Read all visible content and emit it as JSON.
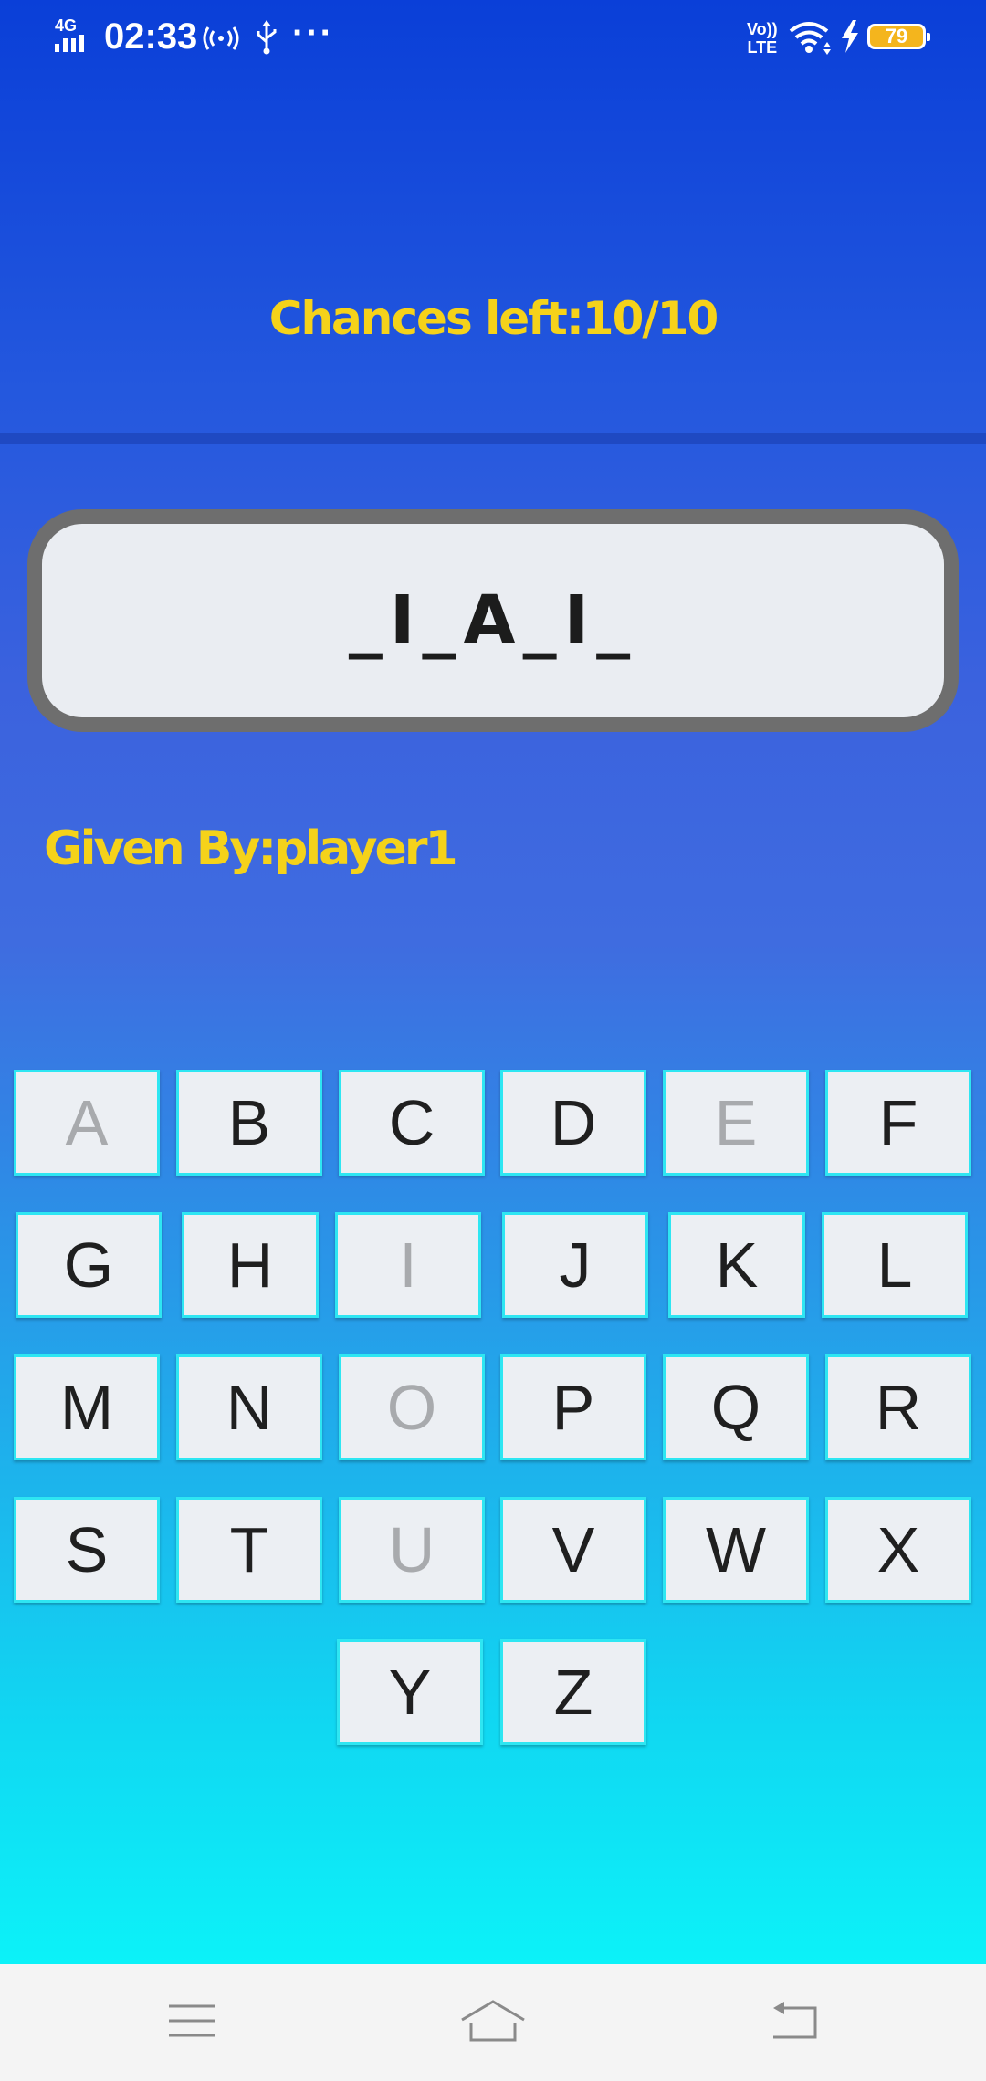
{
  "status_bar": {
    "network": "4G",
    "time": "02:33",
    "volte_top": "Vo))",
    "volte_bottom": "LTE",
    "more": "···",
    "battery": "79",
    "icons": [
      "signal-icon",
      "hotspot-icon",
      "usb-icon",
      "more-icon",
      "volte-icon",
      "wifi-icon",
      "charging-icon",
      "battery-icon"
    ]
  },
  "game": {
    "chances_text": "Chances left:10/10",
    "word_display": "_I_A_I_",
    "given_by_text": "Given By:player1"
  },
  "keyboard": {
    "keys": [
      {
        "letter": "A",
        "used": true
      },
      {
        "letter": "B",
        "used": false
      },
      {
        "letter": "C",
        "used": false
      },
      {
        "letter": "D",
        "used": false
      },
      {
        "letter": "E",
        "used": true
      },
      {
        "letter": "F",
        "used": false
      },
      {
        "letter": "G",
        "used": false
      },
      {
        "letter": "H",
        "used": false
      },
      {
        "letter": "I",
        "used": true
      },
      {
        "letter": "J",
        "used": false
      },
      {
        "letter": "K",
        "used": false
      },
      {
        "letter": "L",
        "used": false
      },
      {
        "letter": "M",
        "used": false
      },
      {
        "letter": "N",
        "used": false
      },
      {
        "letter": "O",
        "used": true
      },
      {
        "letter": "P",
        "used": false
      },
      {
        "letter": "Q",
        "used": false
      },
      {
        "letter": "R",
        "used": false
      },
      {
        "letter": "S",
        "used": false
      },
      {
        "letter": "T",
        "used": false
      },
      {
        "letter": "U",
        "used": true
      },
      {
        "letter": "V",
        "used": false
      },
      {
        "letter": "W",
        "used": false
      },
      {
        "letter": "X",
        "used": false
      },
      {
        "letter": "Y",
        "used": false
      },
      {
        "letter": "Z",
        "used": false
      }
    ]
  },
  "nav_bar": {
    "icons": [
      "menu-icon",
      "home-icon",
      "back-icon"
    ]
  },
  "colors": {
    "accent_text": "#f5d21a",
    "key_border": "#2ee6f2",
    "used_key_text": "#a8aaad"
  }
}
